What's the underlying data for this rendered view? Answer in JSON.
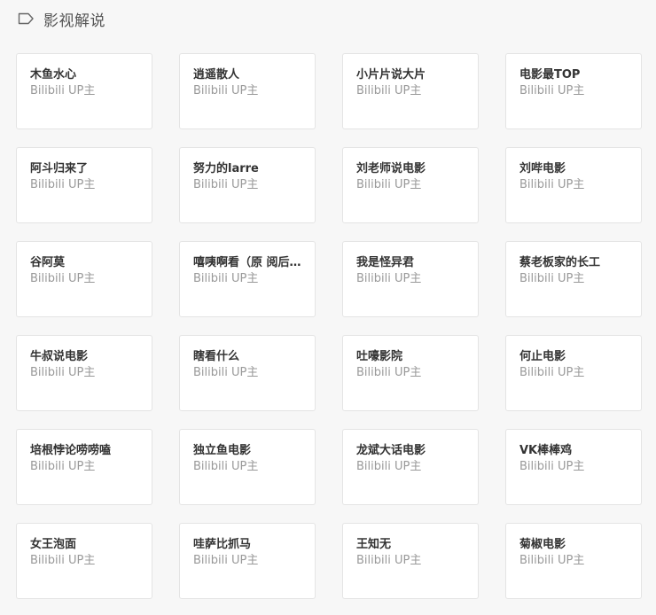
{
  "section": {
    "icon": "tag-icon",
    "title": "影视解说"
  },
  "cards": [
    {
      "name": "木鱼水心",
      "subtitle": "Bilibili UP主"
    },
    {
      "name": "逍遥散人",
      "subtitle": "Bilibili UP主"
    },
    {
      "name": "小片片说大片",
      "subtitle": "Bilibili UP主"
    },
    {
      "name": "电影最TOP",
      "subtitle": "Bilibili UP主"
    },
    {
      "name": "阿斗归来了",
      "subtitle": "Bilibili UP主"
    },
    {
      "name": "努力的larre",
      "subtitle": "Bilibili UP主"
    },
    {
      "name": "刘老师说电影",
      "subtitle": "Bilibili UP主"
    },
    {
      "name": "刘哔电影",
      "subtitle": "Bilibili UP主"
    },
    {
      "name": "谷阿莫",
      "subtitle": "Bilibili UP主"
    },
    {
      "name": "嘻咦啊看（原 阅后…",
      "subtitle": "Bilibili UP主"
    },
    {
      "name": "我是怪异君",
      "subtitle": "Bilibili UP主"
    },
    {
      "name": "蔡老板家的长工",
      "subtitle": "Bilibili UP主"
    },
    {
      "name": "牛叔说电影",
      "subtitle": "Bilibili UP主"
    },
    {
      "name": "瞎看什么",
      "subtitle": "Bilibili UP主"
    },
    {
      "name": "吐嚎影院",
      "subtitle": "Bilibili UP主"
    },
    {
      "name": "何止电影",
      "subtitle": "Bilibili UP主"
    },
    {
      "name": "培根悖论唠唠嗑",
      "subtitle": "Bilibili UP主"
    },
    {
      "name": "独立鱼电影",
      "subtitle": "Bilibili UP主"
    },
    {
      "name": "龙斌大话电影",
      "subtitle": "Bilibili UP主"
    },
    {
      "name": "VK棒棒鸡",
      "subtitle": "Bilibili UP主"
    },
    {
      "name": "女王泡面",
      "subtitle": "Bilibili UP主"
    },
    {
      "name": "哇萨比抓马",
      "subtitle": "Bilibili UP主"
    },
    {
      "name": "王知无",
      "subtitle": "Bilibili UP主"
    },
    {
      "name": "菊椒电影",
      "subtitle": "Bilibili UP主"
    }
  ]
}
